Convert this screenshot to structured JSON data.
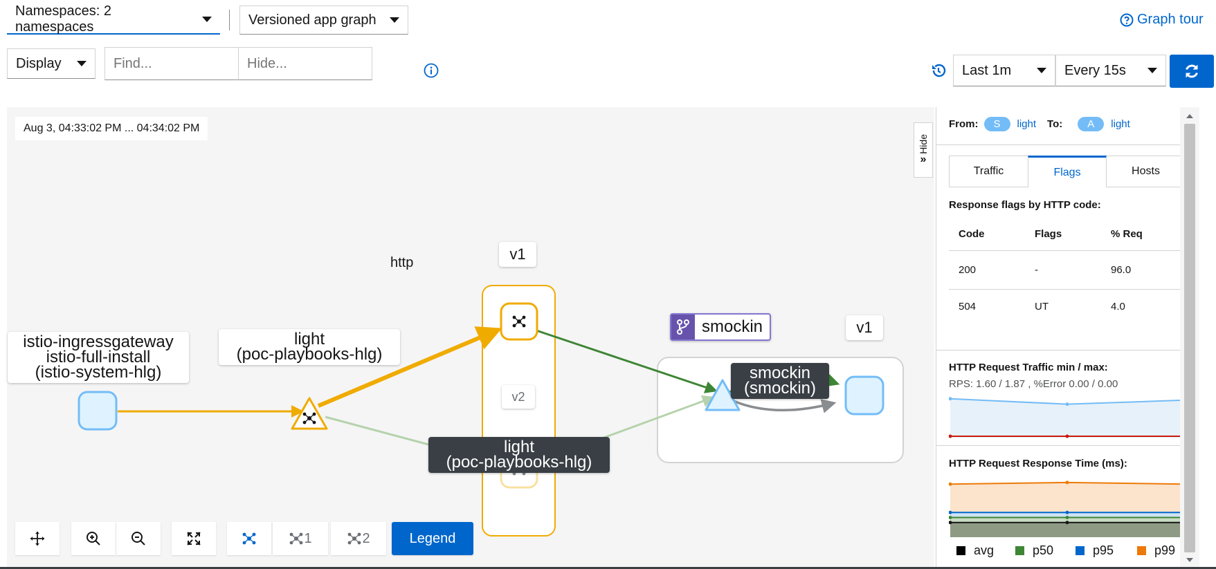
{
  "toolbar": {
    "namespaces_label": "Namespaces: 2 namespaces",
    "graph_type_label": "Versioned app graph",
    "graph_tour_label": "Graph tour",
    "display_label": "Display",
    "find_placeholder": "Find...",
    "hide_placeholder": "Hide...",
    "duration_label": "Last 1m",
    "refresh_interval_label": "Every 15s"
  },
  "graph": {
    "timestamp": "Aug 3, 04:33:02 PM ... 04:34:02 PM",
    "edge_label": "http",
    "nodes": {
      "gateway_line1": "istio-ingressgateway",
      "gateway_line2": "istio-full-install",
      "gateway_line3": "(istio-system-hlg)",
      "light_line1": "light",
      "light_line2": "(poc-playbooks-hlg)",
      "light_v1": "v1",
      "light_v2": "v2",
      "light_box_line1": "light",
      "light_box_line2": "(poc-playbooks-hlg)",
      "smockin_service": "smockin",
      "smockin_v1": "v1",
      "smockin_box_line1": "smockin",
      "smockin_box_line2": "(smockin)"
    },
    "controls": {
      "layout_1": "1",
      "layout_2": "2",
      "legend_label": "Legend"
    },
    "hide_label": "Hide"
  },
  "panel": {
    "from_label": "From:",
    "from_badge": "S",
    "from_name": "light",
    "to_label": "To:",
    "to_badge": "A",
    "to_name": "light",
    "tabs": [
      "Traffic",
      "Flags",
      "Hosts"
    ],
    "flags_title": "Response flags by HTTP code:",
    "table_headers": [
      "Code",
      "Flags",
      "% Req"
    ],
    "table_rows": [
      [
        "200",
        "-",
        "96.0"
      ],
      [
        "504",
        "UT",
        "4.0"
      ]
    ],
    "traffic_title": "HTTP Request Traffic min / max:",
    "traffic_stats": "RPS: 1.60 / 1.87 , %Error 0.00 / 0.00",
    "response_title": "HTTP Request Response Time (ms):",
    "legend": [
      "avg",
      "p50",
      "p95",
      "p99"
    ],
    "colors": {
      "avg": "#151515",
      "p50": "#3e8635",
      "p95": "#0066cc",
      "p99": "#ec7a08"
    }
  },
  "charts": {
    "traffic_rps": [
      1.87,
      1.6,
      1.8
    ],
    "traffic_error": [
      0,
      0,
      0
    ],
    "traffic_range": [
      0,
      2
    ],
    "response": {
      "p99": [
        31,
        32,
        31
      ],
      "p95": [
        14,
        14,
        14
      ],
      "p50": [
        11,
        11,
        11
      ],
      "avg": [
        8,
        8,
        8
      ]
    },
    "response_range": [
      0,
      34
    ]
  }
}
